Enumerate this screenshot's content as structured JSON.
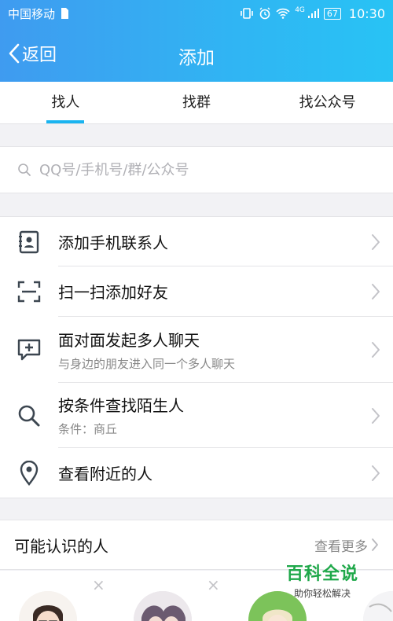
{
  "status_bar": {
    "carrier": "中国移动",
    "network": "4G",
    "battery": "67",
    "time": "10:30"
  },
  "header": {
    "back_label": "返回",
    "title": "添加"
  },
  "tabs": [
    {
      "label": "找人",
      "active": true
    },
    {
      "label": "找群",
      "active": false
    },
    {
      "label": "找公众号",
      "active": false
    }
  ],
  "search": {
    "placeholder": "QQ号/手机号/群/公众号",
    "value": ""
  },
  "menu": [
    {
      "title": "添加手机联系人",
      "subtitle": "",
      "icon": "contact-card-icon"
    },
    {
      "title": "扫一扫添加好友",
      "subtitle": "",
      "icon": "scan-icon"
    },
    {
      "title": "面对面发起多人聊天",
      "subtitle": "与身边的朋友进入同一个多人聊天",
      "icon": "chat-add-icon"
    },
    {
      "title": "按条件查找陌生人",
      "subtitle": "条件：商丘",
      "icon": "search-icon"
    },
    {
      "title": "查看附近的人",
      "subtitle": "",
      "icon": "location-pin-icon"
    }
  ],
  "may_know": {
    "title": "可能认识的人",
    "more_label": "查看更多"
  },
  "watermark": {
    "title": "百科全说",
    "subtitle": "助你轻松解决"
  },
  "colors": {
    "header_gradient_start": "#3f9bf0",
    "header_gradient_end": "#28c3f4",
    "tab_indicator": "#1ab4f0",
    "watermark_green": "#1fa84a"
  }
}
